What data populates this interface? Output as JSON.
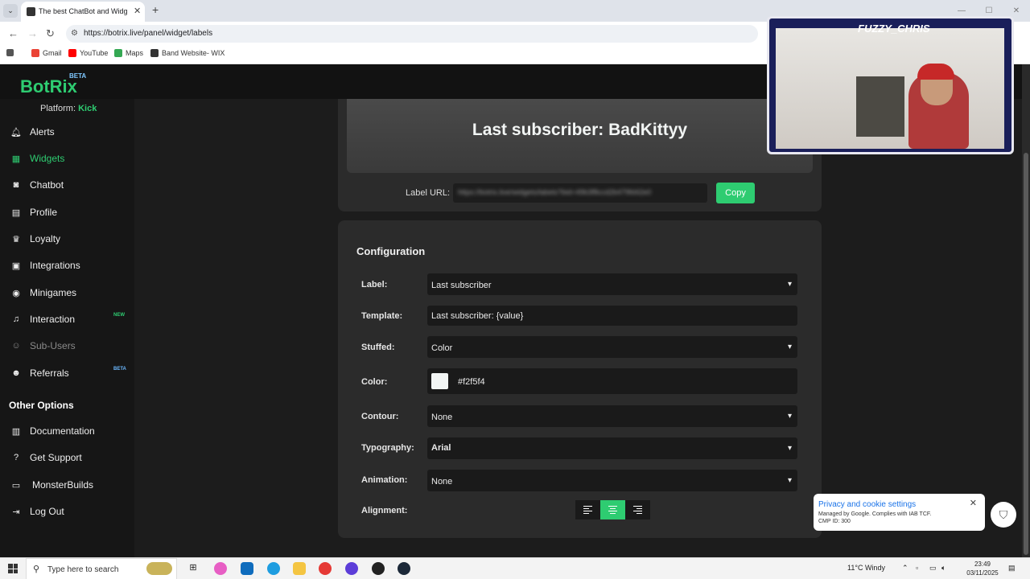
{
  "browser": {
    "tab_title": "The best ChatBot and Widgets",
    "url": "https://botrix.live/panel/widget/labels",
    "bookmarks": [
      "Gmail",
      "YouTube",
      "Maps",
      "Band Website- WIX"
    ]
  },
  "app": {
    "logo": "BotRix",
    "logo_badge": "BETA",
    "platform_label": "Platform:",
    "platform_value": "Kick"
  },
  "sidebar": {
    "items": [
      {
        "label": "Alerts",
        "icon": "bell-icon"
      },
      {
        "label": "Widgets",
        "icon": "grid-icon",
        "active": true
      },
      {
        "label": "Chatbot",
        "icon": "robot-icon"
      },
      {
        "label": "Profile",
        "icon": "id-card-icon"
      },
      {
        "label": "Loyalty",
        "icon": "trophy-icon"
      },
      {
        "label": "Integrations",
        "icon": "plug-icon"
      },
      {
        "label": "Minigames",
        "icon": "gamepad-icon"
      },
      {
        "label": "Interaction",
        "icon": "music-icon",
        "badge": "NEW"
      },
      {
        "label": "Sub-Users",
        "icon": "users-icon",
        "muted": true
      },
      {
        "label": "Referrals",
        "icon": "user-group-icon",
        "badge": "BETA"
      }
    ],
    "other_title": "Other Options",
    "other_items": [
      {
        "label": "Documentation",
        "icon": "book-icon"
      },
      {
        "label": "Get Support",
        "icon": "question-icon"
      },
      {
        "label": "MonsterBuilds",
        "icon": "laptop-icon"
      },
      {
        "label": "Log Out",
        "icon": "logout-icon"
      }
    ]
  },
  "preview": {
    "text": "Last subscriber: BadKittyy",
    "url_label": "Label URL:",
    "url_value": "https://botrix.live/widgets/labels?bid=49b3f8ccd2b479fd42e0",
    "copy_label": "Copy"
  },
  "config": {
    "title": "Configuration",
    "label": {
      "label": "Label:",
      "value": "Last subscriber"
    },
    "template": {
      "label": "Template:",
      "value": "Last subscriber: {value}"
    },
    "stuffed": {
      "label": "Stuffed:",
      "value": "Color"
    },
    "color": {
      "label": "Color:",
      "value": "#f2f5f4"
    },
    "contour": {
      "label": "Contour:",
      "value": "None"
    },
    "typography": {
      "label": "Typography:",
      "value": "Arial"
    },
    "animation": {
      "label": "Animation:",
      "value": "None"
    },
    "alignment": {
      "label": "Alignment:",
      "options": [
        "left",
        "center",
        "right"
      ],
      "selected": "center"
    }
  },
  "webcam": {
    "name": "FUZZY_CHRIS"
  },
  "cookie": {
    "title": "Privacy and cookie settings",
    "line1": "Managed by Google. Complies with IAB TCF.",
    "line2": "CMP ID: 300"
  },
  "taskbar": {
    "search_placeholder": "Type here to search",
    "weather": "11°C  Windy",
    "time": "23:49",
    "date": "03/11/2025"
  },
  "colors": {
    "accent": "#2ecc71",
    "panel": "#2b2b2b",
    "field": "#1a1a1a"
  }
}
